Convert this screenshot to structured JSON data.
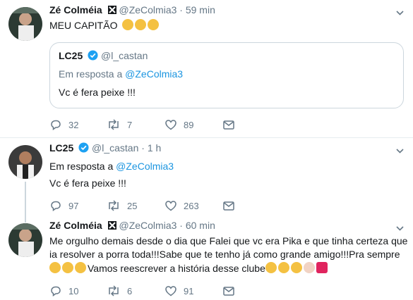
{
  "tweet1": {
    "name": "Zé Colméia",
    "handle": "@ZeColmia3",
    "sep": "·",
    "time": "59 min",
    "text": "MEU CAPITÃO",
    "quote": {
      "name": "LC25",
      "handle": "@l_castan",
      "reply_prefix": "Em resposta a",
      "reply_to": "@ZeColmia3",
      "text": "Vc é fera peixe !!!"
    },
    "replies": "32",
    "retweets": "7",
    "likes": "89"
  },
  "tweet2": {
    "name": "LC25",
    "handle": "@l_castan",
    "sep": "·",
    "time": "1 h",
    "reply_prefix": "Em resposta a",
    "reply_to": "@ZeColmia3",
    "text": "Vc é fera peixe !!!",
    "replies": "97",
    "retweets": "25",
    "likes": "263"
  },
  "tweet3": {
    "name": "Zé Colméia",
    "handle": "@ZeColmia3",
    "sep": "·",
    "time": "60 min",
    "line1": "Me orgulho demais desde o dia que Falei que vc era Pika e que tinha certeza que",
    "line2": "ia resolver a porra toda!!!Sabe que te tenho já como grande amigo!!!Pra sempre",
    "line3": "Vamos reescrever a história desse clube",
    "replies": "10",
    "retweets": "6",
    "likes": "91"
  },
  "colors": {
    "link": "#1b95e0",
    "muted": "#657786",
    "verified": "#1da1f2",
    "divider": "#e6ecf0"
  },
  "icons": [
    "reply-icon",
    "retweet-icon",
    "like-icon",
    "dm-icon",
    "verified-icon",
    "chevron-down-icon",
    "flexed-biceps-emoji",
    "folded-hands-emoji",
    "anger-emoji"
  ]
}
